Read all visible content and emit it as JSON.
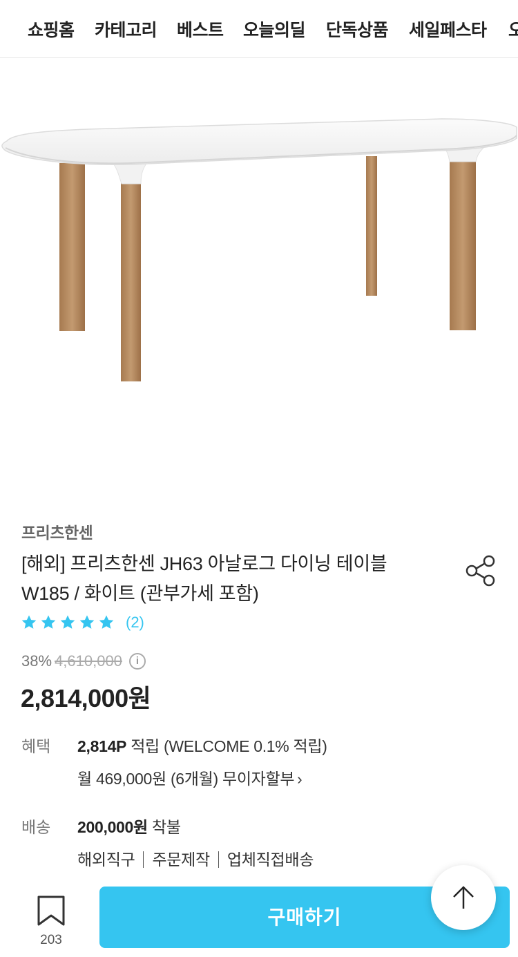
{
  "nav": {
    "tabs": [
      "쇼핑홈",
      "카테고리",
      "베스트",
      "오늘의딜",
      "단독상품",
      "세일페스타",
      "오"
    ]
  },
  "product": {
    "brand": "프리츠한센",
    "title_line1": "[해외] 프리츠한센 JH63 아날로그 다이닝 테이블",
    "title_line2": "W185 / 화이트 (관부가세 포함)",
    "rating": 5,
    "review_count": "(2)",
    "discount": "38%",
    "original_price": "4,610,000",
    "sale_price": "2,814,000원"
  },
  "benefit": {
    "label": "혜택",
    "points_bold": "2,814P",
    "points_rest": " 적립 (WELCOME 0.1% 적립)",
    "installment": "월 469,000원 (6개월) 무이자할부",
    "chevron": "›"
  },
  "delivery": {
    "label": "배송",
    "fee_bold": "200,000원",
    "fee_rest": " 착불",
    "tags": [
      "해외직구",
      "주문제작",
      "업체직접배송"
    ]
  },
  "bottom_bar": {
    "bookmark_count": "203",
    "buy_label": "구매하기"
  },
  "colors": {
    "accent": "#35c5f0",
    "star": "#35c5f0",
    "wood": "#b3865c",
    "table_top": "#f6f6f6"
  },
  "icons": [
    "share-icon",
    "star-icon",
    "info-icon",
    "bookmark-icon",
    "arrow-up-icon"
  ]
}
